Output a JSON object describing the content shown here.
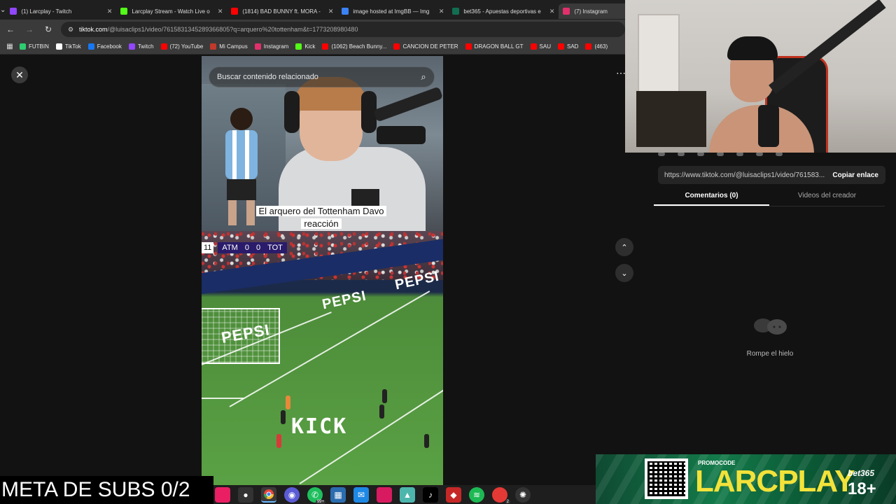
{
  "browser": {
    "tabs": [
      {
        "title": "(1) Larcplay - Twitch",
        "color": "#9146ff",
        "active": false
      },
      {
        "title": "Larcplay Stream - Watch Live o",
        "color": "#53fc18",
        "active": false
      },
      {
        "title": "(1814) BAD BUNNY ft. MORA -",
        "color": "#ff0000",
        "active": false
      },
      {
        "title": "image hosted at ImgBB — Img",
        "color": "#3b82f6",
        "active": false
      },
      {
        "title": "bet365 - Apuestas deportivas e",
        "color": "#126e51",
        "active": false
      },
      {
        "title": "(7) Instagram",
        "color": "#e1306c",
        "active": true
      }
    ],
    "url_host": "tiktok.com",
    "url_rest": "/@luisaclips1/video/7615831345289366805?q=arquero%20tottenham&t=1773208980480",
    "bookmarks": [
      {
        "label": "FUTBIN",
        "color": "#2ecc71"
      },
      {
        "label": "TikTok",
        "color": "#ffffff"
      },
      {
        "label": "Facebook",
        "color": "#1877f2"
      },
      {
        "label": "Twitch",
        "color": "#9146ff"
      },
      {
        "label": "(72) YouTube",
        "color": "#ff0000"
      },
      {
        "label": "Mi Campus",
        "color": "#c0392b"
      },
      {
        "label": "Instagram",
        "color": "#e1306c"
      },
      {
        "label": "Kick",
        "color": "#53fc18"
      },
      {
        "label": "(1062) Beach Bunny...",
        "color": "#ff0000"
      },
      {
        "label": "CANCION DE PETER",
        "color": "#ff0000"
      },
      {
        "label": "DRAGON BALL GT",
        "color": "#ff0000"
      },
      {
        "label": "SAU",
        "color": "#ff0000"
      },
      {
        "label": "SAD",
        "color": "#ff0000"
      },
      {
        "label": "(463)",
        "color": "#ff0000"
      }
    ]
  },
  "video": {
    "search_placeholder": "Buscar contenido relacionado",
    "caption_line1": "El arquero del Tottenham Davo",
    "caption_line2": "reacción",
    "score_time": "11",
    "home_team": "ATM",
    "home_score": "0",
    "away_score": "0",
    "away_team": "TOT",
    "ad_text": "PEPSI",
    "watermark": "KICK"
  },
  "panel": {
    "share_url": "https://www.tiktok.com/@luisaclips1/video/761583...",
    "copy_label": "Copiar enlace",
    "tab_comments": "Comentarios (0)",
    "tab_creator": "Videos del creador",
    "empty_text": "Rompe el hielo"
  },
  "overlay": {
    "meta_subs": "META DE SUBS 0/2",
    "promo_label": "PROMOCODE",
    "promo_code": "LARCPLAY",
    "promo_brand": "bet365",
    "promo_age": "18+",
    "taskbar_badge1": "99+",
    "taskbar_badge2": "2"
  }
}
